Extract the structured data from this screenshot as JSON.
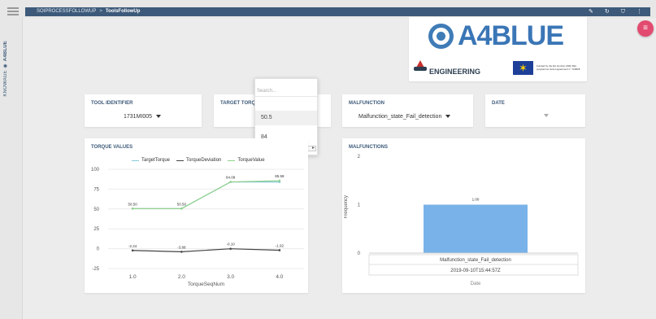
{
  "topbar": {
    "breadcrumb_parent": "SOIPROCESSFOLLOWUP",
    "breadcrumb_current": "ToolsFollowUp",
    "breadcrumb_sep": ">"
  },
  "left_rail": {
    "label_prefix": "KNOWAGE",
    "label_app": "A4BLUE"
  },
  "logo": {
    "brand": "A4BLUE",
    "partner": "ENGINEERING",
    "eu_text": "Funded by the EU Horizon 2020 R&I programme Grant agreement n° 723828"
  },
  "filters": {
    "tool_identifier_label": "TOOL IDENTIFIER",
    "tool_identifier_value": "1731MI005",
    "target_torque_label": "TARGET TORQU",
    "malfunction_label": "MALFUNCTION",
    "malfunction_value": "Malfunction_state_Fail_detection",
    "date_label": "DATE"
  },
  "dropdown": {
    "search_placeholder": "Search...",
    "options": [
      "50.5",
      "84"
    ]
  },
  "torque_chart_card": {
    "title": "TORQUE VALUES"
  },
  "malfunctions_card": {
    "title": "MALFUNCTIONS"
  },
  "chart_data": [
    {
      "type": "line",
      "title": "TORQUE VALUES",
      "xlabel": "TorqueSeqNum",
      "ylabel": "",
      "x": [
        1.0,
        2.0,
        3.0,
        4.0
      ],
      "x_ticks": [
        "1.0",
        "2.0",
        "3.0",
        "4.0"
      ],
      "ylim": [
        -25,
        100
      ],
      "y_ticks": [
        "100",
        "75",
        "50",
        "25",
        "0",
        "-25"
      ],
      "legend_placement": "top",
      "series": [
        {
          "name": "TargetTorque",
          "values": [
            50.5,
            50.5,
            84,
            84
          ],
          "color": "#87c9d9"
        },
        {
          "name": "TorqueDeviation",
          "values": [
            -2.24,
            -3.88,
            -0.1,
            -1.92
          ],
          "color": "#444444"
        },
        {
          "name": "TorqueValue",
          "values": [
            50.5,
            50.5,
            84.08,
            85.58
          ],
          "color": "#8fd18a"
        }
      ],
      "labels": [
        {
          "series": "TorqueValue",
          "text": [
            "50.50",
            "50.50",
            "84.08",
            "85.58"
          ]
        },
        {
          "series": "TorqueDeviation",
          "text": [
            "-2.24",
            "-3.88",
            "-0.10",
            "-1.92"
          ]
        }
      ]
    },
    {
      "type": "bar",
      "title": "MALFUNCTIONS",
      "ylabel": "Frequency",
      "xlabel": "Date",
      "categories": [
        "Malfunction_state_Fail_detection"
      ],
      "sub_category": "2019-09-10T15:44:57Z",
      "values": [
        1.0
      ],
      "value_labels": [
        "1.00"
      ],
      "ylim": [
        0,
        2
      ],
      "y_ticks": [
        "2",
        "1",
        "0"
      ],
      "bar_color": "#79b2e8"
    }
  ]
}
